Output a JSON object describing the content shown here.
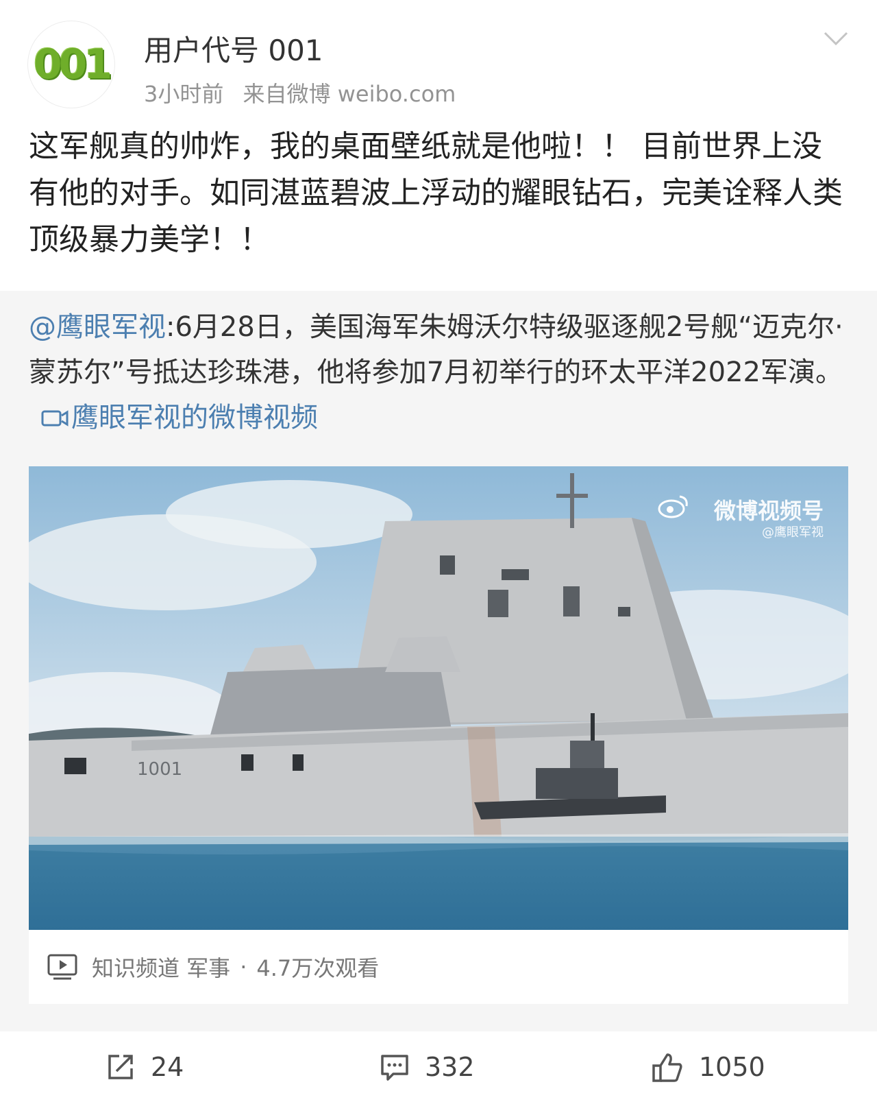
{
  "post": {
    "avatar_text": "001",
    "username": "用户代号 001",
    "time": "3小时前",
    "source": "来自微博 weibo.com",
    "text": "这军舰真的帅炸，我的桌面壁纸就是他啦！！ 目前世界上没有他的对手。如同湛蓝碧波上浮动的耀眼钻石，完美诠释人类顶级暴力美学！！"
  },
  "repost": {
    "mention": "@鹰眼军视",
    "text": ":6月28日，美国海军朱姆沃尔特级驱逐舰2号舰“迈克尔·蒙苏尔”号抵达珍珠港，他将参加7月初举行的环太平洋2022军演。",
    "video_link": "鹰眼军视的微博视频",
    "video": {
      "watermark": "微博视频号",
      "watermark_sub": "@鹰眼军视",
      "hull_number": "1001",
      "info_channel": "知识频道 军事",
      "info_views": "4.7万次观看"
    }
  },
  "actions": {
    "repost_count": "24",
    "comment_count": "332",
    "like_count": "1050"
  },
  "icons": [
    "chevron-down-icon",
    "video-link-icon",
    "weibo-logo-icon",
    "play-icon",
    "repost-icon",
    "comment-icon",
    "like-icon"
  ],
  "colors": {
    "link": "#4c7fb0",
    "repost_bg": "#f5f5f5",
    "avatar_green": "#6fae2a"
  }
}
